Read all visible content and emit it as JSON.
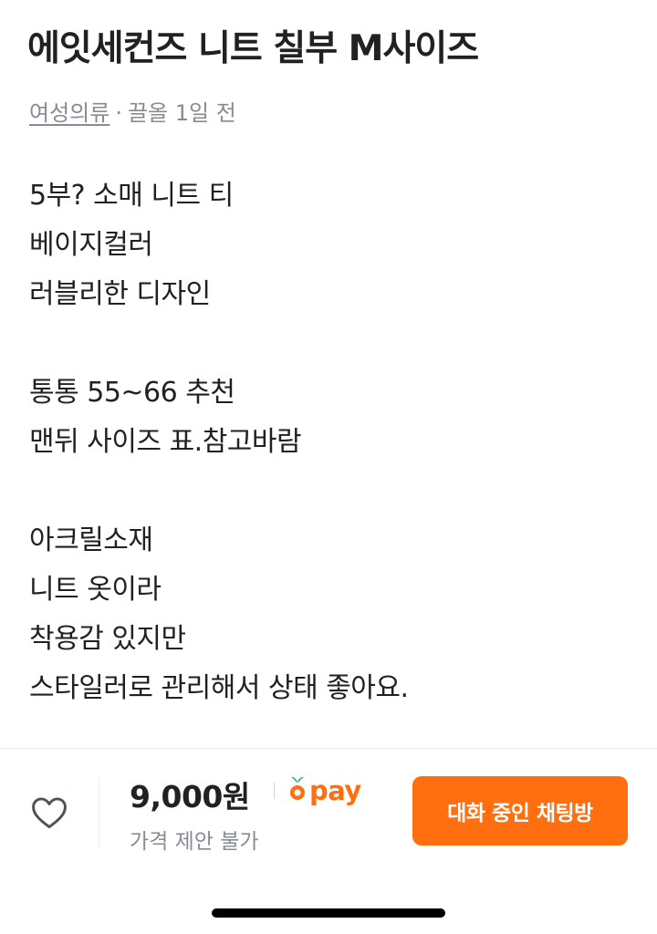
{
  "product": {
    "title": "에잇세컨즈 니트 칠부 M사이즈",
    "category": "여성의류",
    "separator": "·",
    "time": "끌올 1일 전",
    "description": [
      "5부? 소매 니트 티",
      "베이지컬러",
      "러블리한 디자인",
      "",
      "통통 55~66 추천",
      "맨뒤 사이즈 표.참고바람",
      "",
      "아크릴소재",
      "니트 옷이라",
      "착용감 있지만",
      "스타일러로 관리해서 상태 좋아요."
    ]
  },
  "bottom_bar": {
    "like_icon": "heart-outline-icon",
    "price": "9,000원",
    "pay_label": "pay",
    "pay_icon": "karrot-pay-icon",
    "negotiation": "가격 제안 불가",
    "chat_button_label": "대화 중인 채팅방",
    "accent_color": "#ff6f0f"
  }
}
